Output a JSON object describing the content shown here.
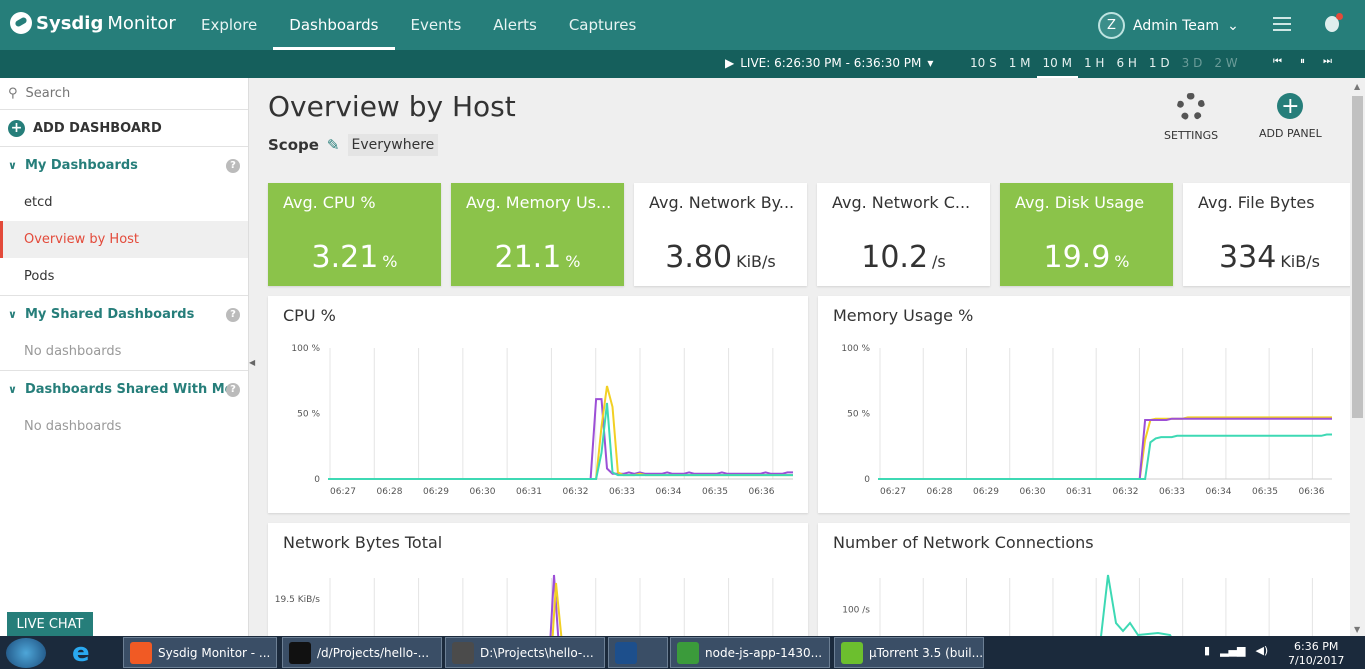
{
  "app": {
    "logo_bold": "Sysdig",
    "logo_rest": "Monitor"
  },
  "nav": [
    "Explore",
    "Dashboards",
    "Events",
    "Alerts",
    "Captures"
  ],
  "user": {
    "initial": "Z",
    "name": "Admin Team"
  },
  "timebar": {
    "live": "LIVE: 6:26:30 PM - 6:36:30 PM",
    "ranges": [
      "10 S",
      "1 M",
      "10 M",
      "1 H",
      "6 H",
      "1 D",
      "3 D",
      "2 W"
    ],
    "active": "10 M"
  },
  "sidebar": {
    "search_placeholder": "Search",
    "add": "ADD DASHBOARD",
    "my": "My Dashboards",
    "my_items": [
      "etcd",
      "Overview by Host",
      "Pods"
    ],
    "shared": "My Shared Dashboards",
    "shared_empty": "No dashboards",
    "shared_with_me": "Dashboards Shared With Me",
    "shared_with_me_empty": "No dashboards",
    "live_chat": "LIVE CHAT"
  },
  "main": {
    "title": "Overview by Host",
    "scope_label": "Scope",
    "scope_value": "Everywhere",
    "settings": "SETTINGS",
    "add_panel": "ADD PANEL"
  },
  "tiles": [
    {
      "label": "Avg. CPU %",
      "value": "3.21",
      "unit": "%",
      "green": true
    },
    {
      "label": "Avg. Memory Us...",
      "value": "21.1",
      "unit": "%",
      "green": true
    },
    {
      "label": "Avg. Network By...",
      "value": "3.80",
      "unit": "KiB/s",
      "green": false
    },
    {
      "label": "Avg. Network C...",
      "value": "10.2",
      "unit": "/s",
      "green": false
    },
    {
      "label": "Avg. Disk Usage",
      "value": "19.9",
      "unit": "%",
      "green": true
    },
    {
      "label": "Avg. File Bytes",
      "value": "334",
      "unit": "KiB/s",
      "green": false
    }
  ],
  "charts": [
    {
      "title": "CPU %",
      "yticks": [
        "100 %",
        "50 %",
        "0"
      ],
      "ylim": [
        0,
        100
      ],
      "x": [
        "06:27",
        "06:28",
        "06:29",
        "06:30",
        "06:31",
        "06:32",
        "06:33",
        "06:34",
        "06:35",
        "06:36"
      ],
      "series": [
        {
          "color": "#9c4fd6",
          "values": [
            0,
            0,
            0,
            0,
            0,
            0,
            0,
            0,
            0,
            0,
            0,
            0,
            0,
            0,
            0,
            0,
            0,
            0,
            0,
            0,
            0,
            0,
            0,
            0,
            0,
            0,
            0,
            0,
            0,
            0,
            0,
            0,
            0,
            0,
            0,
            0,
            0,
            0,
            0,
            0,
            0,
            0,
            0,
            0,
            0,
            0,
            0,
            0,
            0,
            61,
            61,
            8,
            4,
            4,
            4,
            5,
            4,
            5,
            4,
            4,
            4,
            4,
            5,
            4,
            4,
            4,
            5,
            4,
            4,
            4,
            4,
            4,
            5,
            4,
            4,
            4,
            4,
            4,
            4,
            4,
            5,
            4,
            4,
            4,
            5,
            5
          ]
        },
        {
          "color": "#f2d024",
          "values": [
            0,
            0,
            0,
            0,
            0,
            0,
            0,
            0,
            0,
            0,
            0,
            0,
            0,
            0,
            0,
            0,
            0,
            0,
            0,
            0,
            0,
            0,
            0,
            0,
            0,
            0,
            0,
            0,
            0,
            0,
            0,
            0,
            0,
            0,
            0,
            0,
            0,
            0,
            0,
            0,
            0,
            0,
            0,
            0,
            0,
            0,
            0,
            0,
            0,
            0,
            40,
            71,
            55,
            5,
            3,
            3,
            3,
            4,
            3,
            3,
            3,
            3,
            3,
            3,
            3,
            3,
            3,
            3,
            3,
            3,
            3,
            3,
            3,
            3,
            3,
            3,
            3,
            3,
            3,
            3,
            3,
            3,
            3,
            3,
            3,
            3
          ]
        },
        {
          "color": "#3dd9b4",
          "values": [
            0,
            0,
            0,
            0,
            0,
            0,
            0,
            0,
            0,
            0,
            0,
            0,
            0,
            0,
            0,
            0,
            0,
            0,
            0,
            0,
            0,
            0,
            0,
            0,
            0,
            0,
            0,
            0,
            0,
            0,
            0,
            0,
            0,
            0,
            0,
            0,
            0,
            0,
            0,
            0,
            0,
            0,
            0,
            0,
            0,
            0,
            0,
            0,
            0,
            0,
            20,
            58,
            5,
            3,
            3,
            3,
            3,
            3,
            3,
            3,
            3,
            3,
            3,
            3,
            3,
            3,
            3,
            3,
            3,
            3,
            3,
            3,
            3,
            3,
            3,
            3,
            3,
            3,
            3,
            3,
            3,
            3,
            3,
            3,
            3,
            3
          ]
        }
      ]
    },
    {
      "title": "Memory Usage %",
      "yticks": [
        "100 %",
        "50 %",
        "0"
      ],
      "ylim": [
        0,
        100
      ],
      "x": [
        "06:27",
        "06:28",
        "06:29",
        "06:30",
        "06:31",
        "06:32",
        "06:33",
        "06:34",
        "06:35",
        "06:36"
      ],
      "series": [
        {
          "color": "#f2d024",
          "values": [
            0,
            0,
            0,
            0,
            0,
            0,
            0,
            0,
            0,
            0,
            0,
            0,
            0,
            0,
            0,
            0,
            0,
            0,
            0,
            0,
            0,
            0,
            0,
            0,
            0,
            0,
            0,
            0,
            0,
            0,
            0,
            0,
            0,
            0,
            0,
            0,
            0,
            0,
            0,
            0,
            0,
            0,
            0,
            0,
            0,
            0,
            0,
            0,
            0,
            0,
            30,
            45,
            46,
            46,
            46,
            46,
            46,
            46,
            47,
            47,
            47,
            47,
            47,
            47,
            47,
            47,
            47,
            47,
            47,
            47,
            47,
            47,
            47,
            47,
            47,
            47,
            47,
            47,
            47,
            47,
            47,
            47,
            47,
            47,
            47,
            47
          ]
        },
        {
          "color": "#9c4fd6",
          "values": [
            0,
            0,
            0,
            0,
            0,
            0,
            0,
            0,
            0,
            0,
            0,
            0,
            0,
            0,
            0,
            0,
            0,
            0,
            0,
            0,
            0,
            0,
            0,
            0,
            0,
            0,
            0,
            0,
            0,
            0,
            0,
            0,
            0,
            0,
            0,
            0,
            0,
            0,
            0,
            0,
            0,
            0,
            0,
            0,
            0,
            0,
            0,
            0,
            0,
            0,
            45,
            45,
            45,
            45,
            45,
            46,
            46,
            46,
            46,
            46,
            46,
            46,
            46,
            46,
            46,
            46,
            46,
            46,
            46,
            46,
            46,
            46,
            46,
            46,
            46,
            46,
            46,
            46,
            46,
            46,
            46,
            46,
            46,
            46,
            46,
            46
          ]
        },
        {
          "color": "#3dd9b4",
          "values": [
            0,
            0,
            0,
            0,
            0,
            0,
            0,
            0,
            0,
            0,
            0,
            0,
            0,
            0,
            0,
            0,
            0,
            0,
            0,
            0,
            0,
            0,
            0,
            0,
            0,
            0,
            0,
            0,
            0,
            0,
            0,
            0,
            0,
            0,
            0,
            0,
            0,
            0,
            0,
            0,
            0,
            0,
            0,
            0,
            0,
            0,
            0,
            0,
            0,
            0,
            0,
            28,
            31,
            32,
            32,
            32,
            33,
            33,
            33,
            33,
            33,
            33,
            33,
            33,
            33,
            33,
            33,
            33,
            33,
            33,
            33,
            33,
            33,
            33,
            33,
            33,
            33,
            33,
            33,
            33,
            33,
            33,
            33,
            33,
            34,
            34
          ]
        }
      ]
    },
    {
      "title": "Network Bytes Total",
      "yticks": [
        "19.5 KiB/s"
      ],
      "ylim": [
        0,
        25
      ],
      "x": [],
      "series": [
        {
          "color": "#9c4fd6",
          "values": [
            0,
            0,
            0,
            0,
            0,
            0,
            0,
            0,
            0,
            0,
            0,
            0,
            0,
            0,
            0,
            0,
            0,
            0,
            0,
            0,
            0,
            0,
            0,
            0,
            0,
            0,
            0,
            0,
            0,
            0,
            0,
            0,
            0,
            0,
            0,
            0,
            0,
            0,
            0,
            0,
            0,
            0,
            0,
            0,
            0,
            0,
            0,
            0,
            0,
            0,
            0,
            0,
            0,
            0,
            0,
            0,
            0,
            0,
            0,
            0,
            0,
            0,
            0,
            0,
            0,
            0,
            0,
            0,
            0,
            0,
            0,
            0,
            0,
            0,
            0,
            0,
            0,
            0,
            0,
            0,
            0,
            0,
            0,
            0,
            0,
            0
          ]
        },
        {
          "color": "#f2d024",
          "values": [
            0,
            0,
            0,
            0,
            0,
            0,
            0,
            0,
            0,
            0,
            0,
            0,
            0,
            0,
            0,
            0,
            0,
            0,
            0,
            0,
            0,
            0,
            0,
            0,
            0,
            0,
            0,
            0,
            0,
            0,
            0,
            0,
            0,
            0,
            0,
            0,
            0,
            0,
            0,
            0,
            0,
            0,
            0,
            0,
            0,
            0,
            0,
            0,
            0,
            0,
            0,
            0,
            0,
            0,
            0,
            0,
            0,
            0,
            0,
            0,
            0,
            0,
            0,
            0,
            0,
            0,
            0,
            0,
            0,
            0,
            0,
            0,
            0,
            0,
            0,
            0,
            0,
            0,
            0,
            0,
            0,
            0,
            0,
            0,
            0,
            0
          ]
        }
      ]
    },
    {
      "title": "Number of Network Connections",
      "yticks": [
        "100 /s"
      ],
      "ylim": [
        0,
        150
      ],
      "x": [],
      "series": [
        {
          "color": "#3dd9b4",
          "values": [
            0,
            0,
            0,
            0,
            0,
            0,
            0,
            0,
            0,
            0,
            0,
            0,
            0,
            0,
            0,
            0,
            0,
            0,
            0,
            0,
            0,
            0,
            0,
            0,
            0,
            0,
            0,
            0,
            0,
            0,
            0,
            0,
            0,
            0,
            0,
            0,
            0,
            0,
            0,
            0,
            0,
            0,
            0,
            0,
            0,
            0,
            0,
            0,
            0,
            0,
            0,
            0,
            0,
            0,
            0,
            0,
            0,
            0,
            0,
            0,
            0,
            0,
            0,
            0,
            0,
            0,
            0,
            0,
            0,
            0,
            0,
            0,
            0,
            0,
            0,
            0,
            0,
            0,
            0,
            0,
            0,
            0,
            0,
            0,
            0,
            0
          ]
        }
      ]
    }
  ],
  "taskbar": {
    "items": [
      {
        "label": "Sysdig Monitor - ...",
        "color": "#f15a24"
      },
      {
        "label": "/d/Projects/hello-...",
        "color": "#111"
      },
      {
        "label": "D:\\Projects\\hello-...",
        "color": "#4b4b4b"
      },
      {
        "label": "",
        "color": "#1d4f8c"
      },
      {
        "label": "node-js-app-1430...",
        "color": "#3b9b3b"
      },
      {
        "label": "µTorrent 3.5  (buil...",
        "color": "#6cbf2e"
      }
    ],
    "time": "6:36 PM",
    "date": "7/10/2017"
  }
}
